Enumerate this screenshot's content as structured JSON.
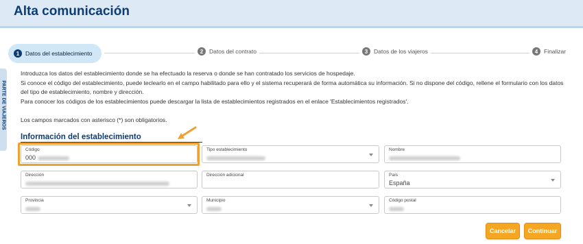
{
  "header": {
    "title": "Alta comunicación"
  },
  "side_tab": {
    "label": "PARTE DE VIAJEROS"
  },
  "stepper": [
    {
      "number": "1",
      "label": "Datos del establecimiento"
    },
    {
      "number": "2",
      "label": "Datos del contrato"
    },
    {
      "number": "3",
      "label": "Datos de los viajeros"
    },
    {
      "number": "4",
      "label": "Finalizar"
    }
  ],
  "intro": {
    "p1": "Introduzca los datos del establecimiento donde se ha efectuado la reserva o donde se han contratado los servicios de hospedaje.",
    "p2": "Si conoce el código del establecimiento, puede teclearlo en el campo habilitado para ello y el sistema recuperará de forma automática su información. Si no dispone del código, rellene el formulario con los datos del tipo de establecimiento, nombre y dirección.",
    "p3": "Para conocer los códigos de los establecimientos puede descargar la lista de establecimientos registrados en el enlace 'Establecimientos registrados'.",
    "required_note": "Los campos marcados con asterisco (*) son obligatorios."
  },
  "section": {
    "title": "Información del establecimiento"
  },
  "fields": {
    "codigo": {
      "label": "Código",
      "value": "000"
    },
    "tipo": {
      "label": "Tipo establecimiento"
    },
    "nombre": {
      "label": "Nombre"
    },
    "direccion": {
      "label": "Dirección"
    },
    "direccion_adicional": {
      "label": "Dirección adicional"
    },
    "pais": {
      "label": "País",
      "value": "España"
    },
    "provincia": {
      "label": "Provincia"
    },
    "municipio": {
      "label": "Municipio"
    },
    "codigo_postal": {
      "label": "Código postal"
    }
  },
  "buttons": {
    "cancel": "Cancelar",
    "continue": "Continuar"
  },
  "colors": {
    "accent": "#f5a623",
    "primary": "#0d3c73",
    "highlight": "#f0a030"
  }
}
